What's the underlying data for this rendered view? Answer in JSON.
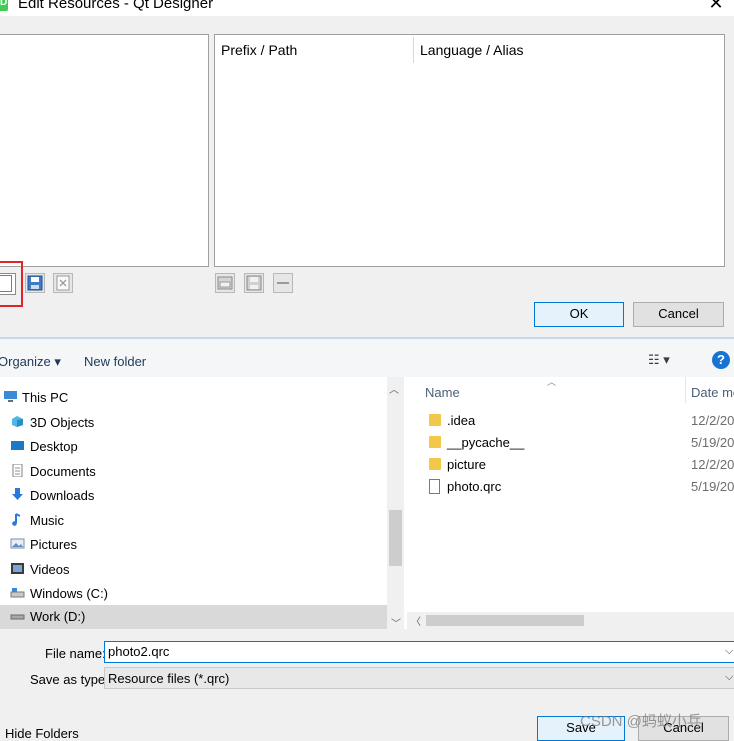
{
  "qt_dialog": {
    "title": "Edit Resources - Qt Designer",
    "app_icon_letter": "D",
    "close_glyph": "✕",
    "columns": [
      "Prefix / Path",
      "Language / Alias"
    ],
    "ok_label": "OK",
    "cancel_label": "Cancel",
    "toolbar_icons": [
      "new-file-icon",
      "save-icon",
      "remove-file-icon",
      "add-prefix-icon",
      "add-files-icon",
      "remove-item-icon"
    ],
    "highlight_color": "#e0242a"
  },
  "save_dialog": {
    "organize_label": "Organize ▾",
    "new_folder_label": "New folder",
    "view_glyph": "☷ ▾",
    "help_glyph": "?",
    "nav_items": [
      {
        "label": "This PC",
        "icon": "pc-icon"
      },
      {
        "label": "3D Objects",
        "icon": "cube-icon"
      },
      {
        "label": "Desktop",
        "icon": "desktop-icon"
      },
      {
        "label": "Documents",
        "icon": "document-icon"
      },
      {
        "label": "Downloads",
        "icon": "download-icon"
      },
      {
        "label": "Music",
        "icon": "music-icon"
      },
      {
        "label": "Pictures",
        "icon": "pictures-icon"
      },
      {
        "label": "Videos",
        "icon": "videos-icon"
      },
      {
        "label": "Windows (C:)",
        "icon": "drive-icon"
      },
      {
        "label": "Work (D:)",
        "icon": "drive-icon"
      }
    ],
    "columns": {
      "name": "Name",
      "date": "Date mo"
    },
    "files": [
      {
        "name": ".idea",
        "date": "12/2/20",
        "type": "folder"
      },
      {
        "name": "__pycache__",
        "date": "5/19/20",
        "type": "folder"
      },
      {
        "name": "picture",
        "date": "12/2/20",
        "type": "folder"
      },
      {
        "name": "photo.qrc",
        "date": "5/19/20",
        "type": "file"
      }
    ],
    "file_name_label": "File name:",
    "file_name_value": "photo2.qrc",
    "save_type_label": "Save as type:",
    "save_type_value": "Resource files (*.qrc)",
    "hide_folders_label": "Hide Folders",
    "save_label": "Save",
    "cancel_label": "Cancel",
    "watermark": "CSDN @蚂蚁小兵"
  }
}
